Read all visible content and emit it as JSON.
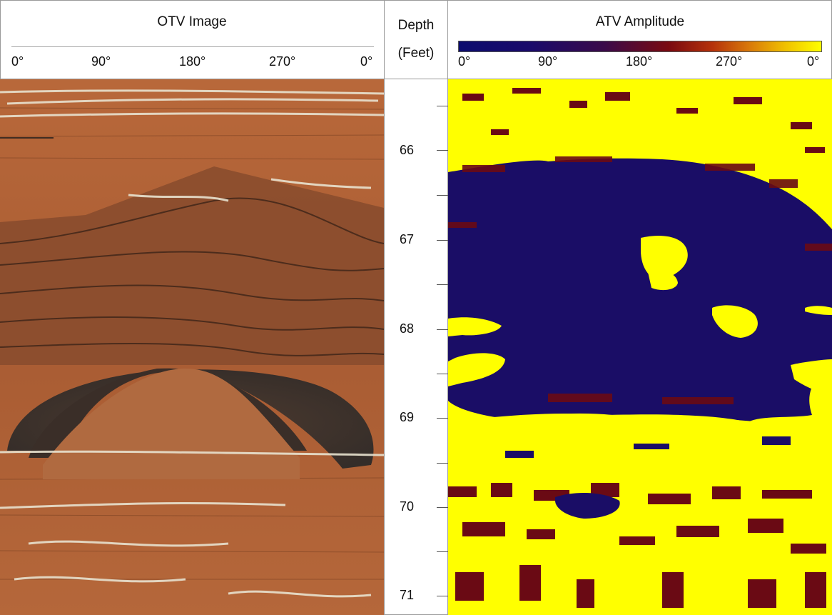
{
  "otv": {
    "title": "OTV Image",
    "ticks": [
      "0°",
      "90°",
      "180°",
      "270°",
      "0°"
    ]
  },
  "depth": {
    "title": "Depth",
    "unit": "(Feet)",
    "labels": [
      "66",
      "67",
      "68",
      "69",
      "70",
      "71"
    ]
  },
  "atv": {
    "title": "ATV Amplitude",
    "ticks": [
      "0°",
      "90°",
      "180°",
      "270°",
      "0°"
    ],
    "colorbar_colors": [
      "#0c0c6e",
      "#3a0a4a",
      "#7a0a10",
      "#d8780a",
      "#ffff00"
    ]
  }
}
